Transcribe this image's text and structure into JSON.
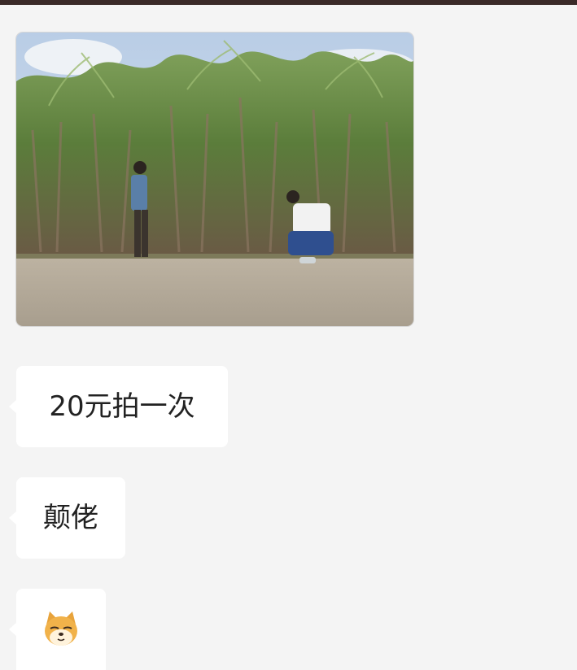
{
  "chat": {
    "messages": [
      {
        "type": "image",
        "icon": "photo-sugarcane-field"
      },
      {
        "type": "text",
        "text": "20元拍一次"
      },
      {
        "type": "text",
        "text": "颠佬"
      },
      {
        "type": "sticker",
        "icon": "doge-emoji-icon"
      }
    ]
  },
  "colors": {
    "background": "#f4f4f4",
    "bubble": "#ffffff",
    "text": "#222222",
    "top_strip": "#3a2a28"
  }
}
